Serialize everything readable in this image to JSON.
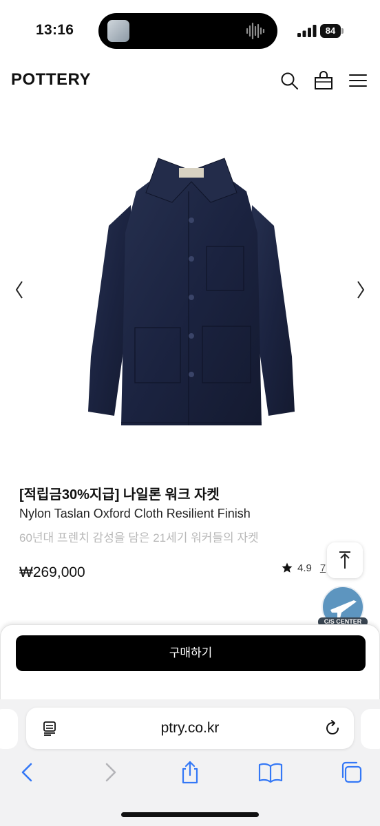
{
  "status_bar": {
    "time": "13:16",
    "battery": "84",
    "icons": [
      "signal-icon",
      "battery-icon",
      "audio-wave-icon"
    ]
  },
  "header": {
    "logo": "POTTERY",
    "icons": [
      "search-icon",
      "shopping-bag-icon",
      "menu-icon"
    ]
  },
  "gallery": {
    "icons": [
      "chevron-left-icon",
      "chevron-right-icon"
    ]
  },
  "product": {
    "title": "[적립금30%지급] 나일론 워크 자켓",
    "subtitle": "Nylon Taslan Oxford Cloth Resilient Finish",
    "description": "60년대 프렌치 감성을 담은 21세기 워커들의 자켓",
    "price": "₩269,000",
    "rating": "4.9",
    "reviews": "7"
  },
  "floating": {
    "cs_label": "C/S CENTER",
    "icons": [
      "scroll-top-icon",
      "airplane-icon"
    ]
  },
  "purchase": {
    "buy_label": "구매하기"
  },
  "browser": {
    "url": "ptry.co.kr",
    "icons": [
      "reader-icon",
      "reload-icon",
      "back-icon",
      "forward-icon",
      "share-icon",
      "bookmarks-icon",
      "tabs-icon"
    ]
  },
  "colors": {
    "jacket": "#1c2541",
    "button": "#000000",
    "safari_bg": "#f2f2f3",
    "link_blue": "#3478f6"
  }
}
